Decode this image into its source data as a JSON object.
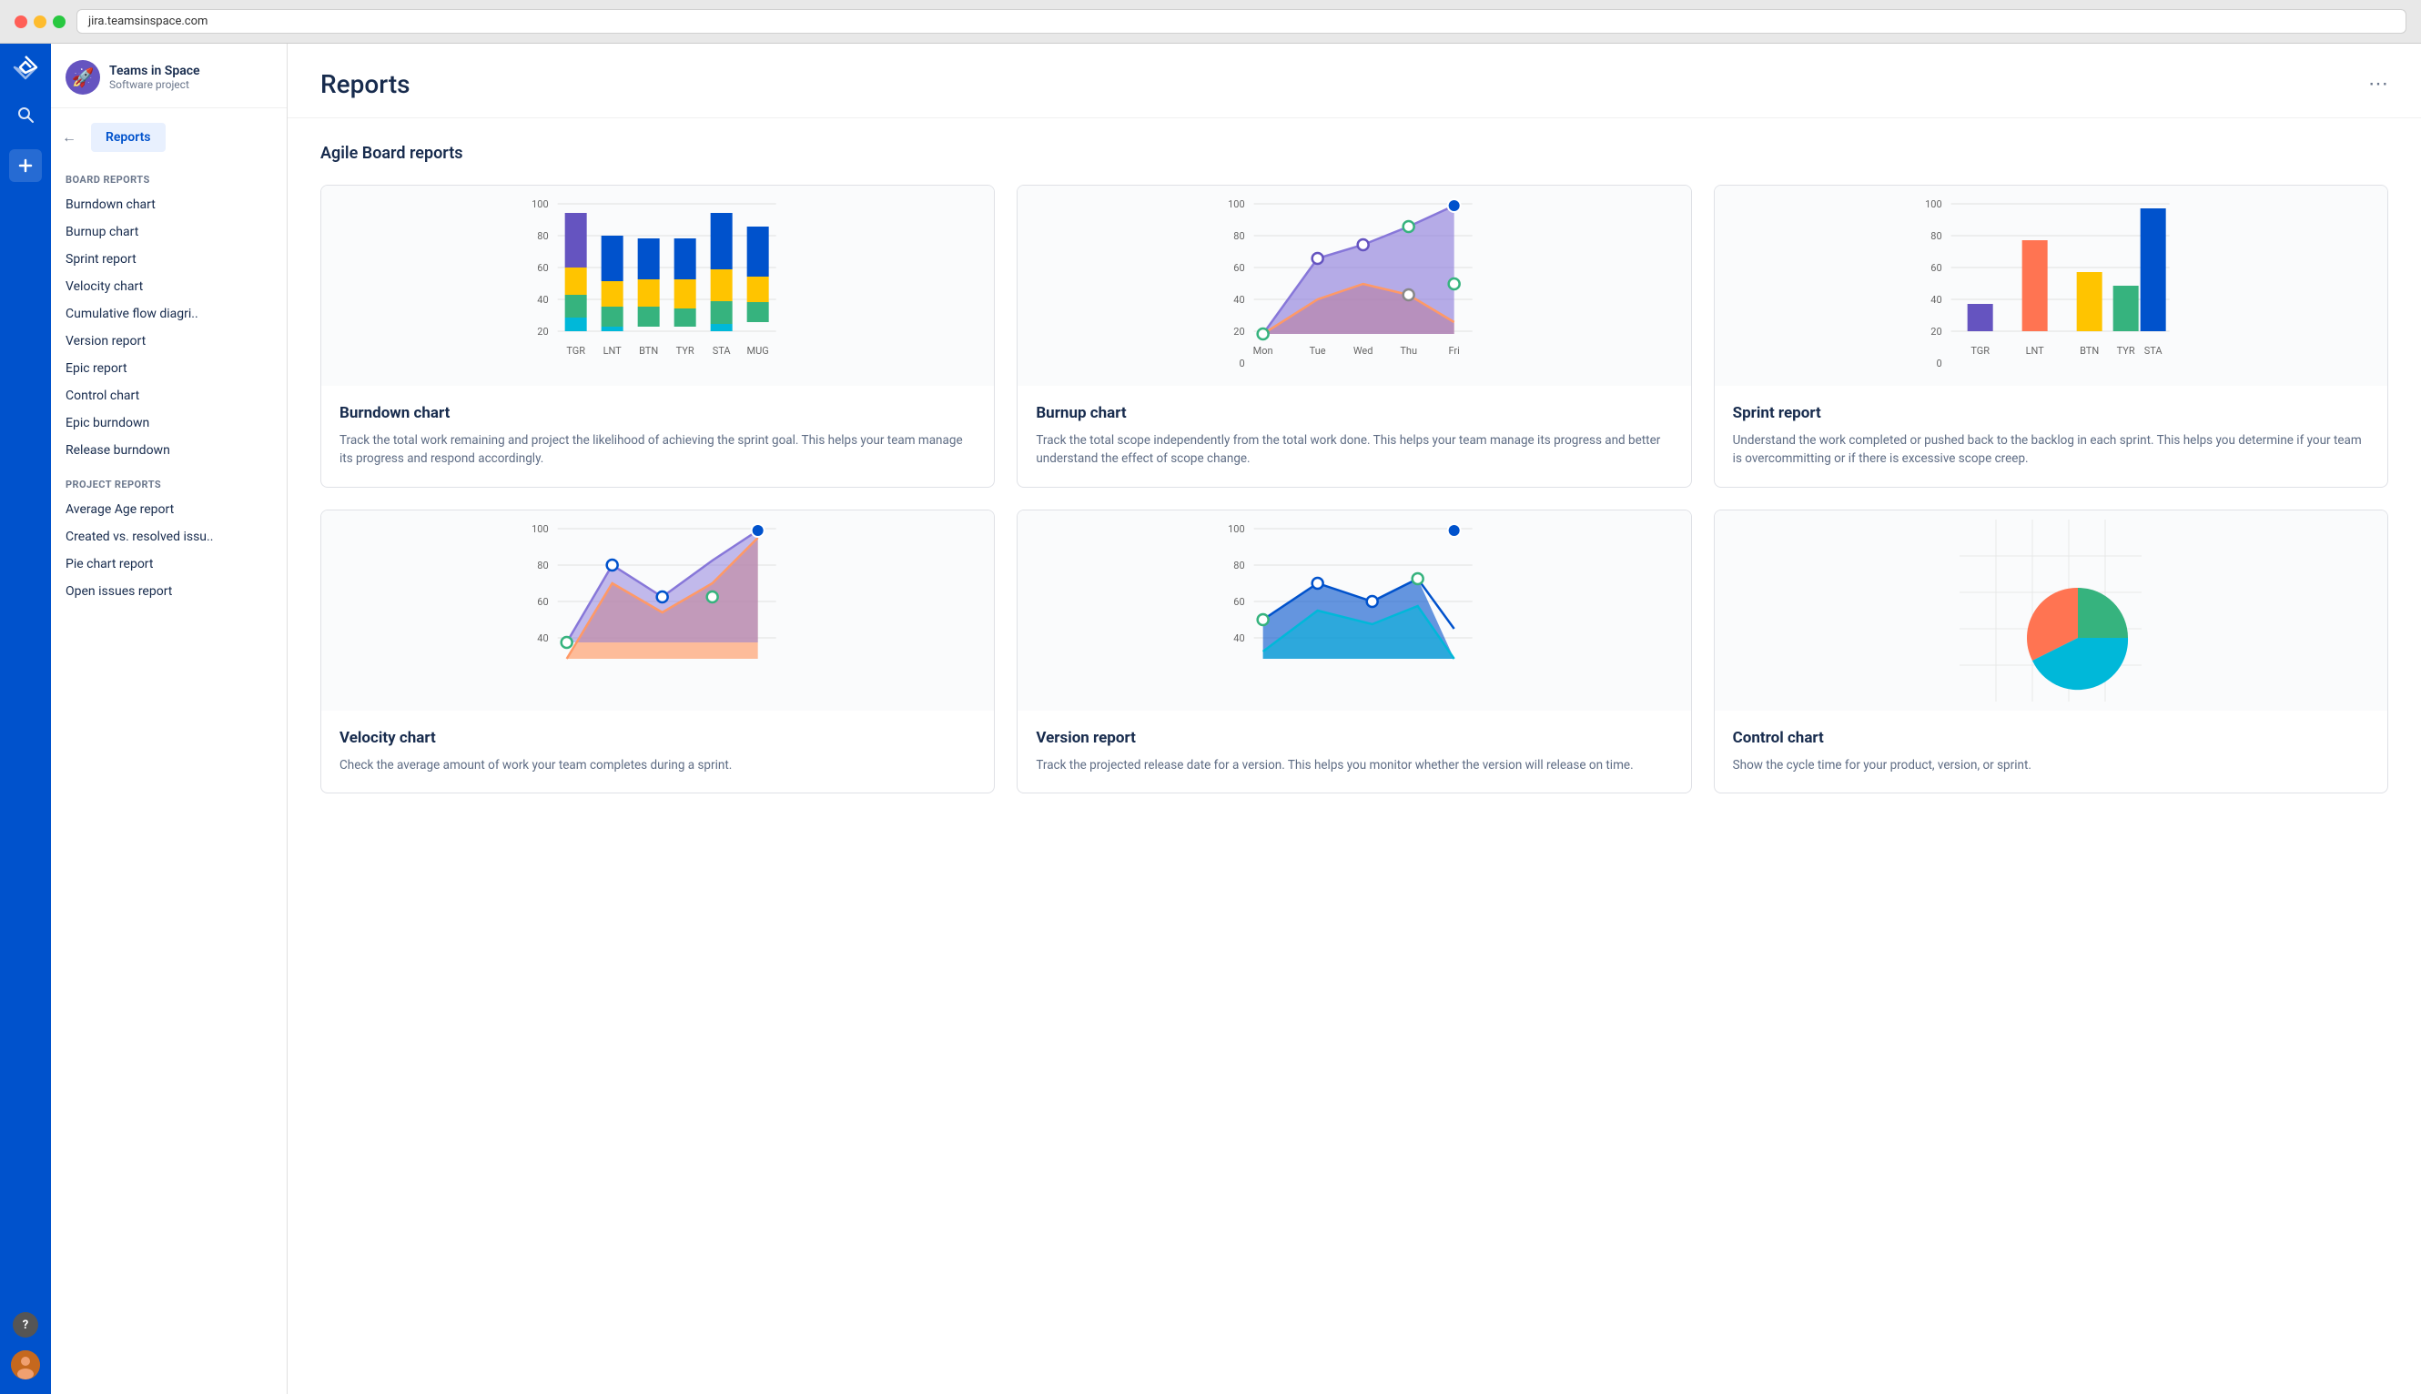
{
  "browser": {
    "url": "jira.teamsinspace.com"
  },
  "project": {
    "name": "Teams in Space",
    "type": "Software project",
    "emoji": "🚀"
  },
  "page": {
    "title": "Reports",
    "section": "Agile Board reports",
    "more_label": "⋯"
  },
  "nav": {
    "back_label": "Reports",
    "board_reports_label": "BOARD REPORTS",
    "project_reports_label": "PROJECT REPORTS",
    "board_items": [
      "Burndown chart",
      "Burnup chart",
      "Sprint report",
      "Velocity chart",
      "Cumulative flow diagri..",
      "Version report",
      "Epic report",
      "Control chart",
      "Epic burndown",
      "Release burndown"
    ],
    "project_items": [
      "Average Age report",
      "Created vs. resolved issu..",
      "Pie chart report",
      "Open issues report"
    ]
  },
  "cards": [
    {
      "id": "burndown",
      "title": "Burndown chart",
      "description": "Track the total work remaining and project the likelihood of achieving the sprint goal. This helps your team manage its progress and respond accordingly."
    },
    {
      "id": "burnup",
      "title": "Burnup chart",
      "description": "Track the total scope independently from the total work done. This helps your team manage its progress and better understand the effect of scope change."
    },
    {
      "id": "sprint",
      "title": "Sprint report",
      "description": "Understand the work completed or pushed back to the backlog in each sprint. This helps you determine if your team is overcommitting or if there is excessive scope creep."
    },
    {
      "id": "velocity",
      "title": "Velocity chart",
      "description": "Check the average amount of work your team completes during a sprint."
    },
    {
      "id": "version",
      "title": "Version report",
      "description": "Track the projected release date for a version. This helps you monitor whether the version will release on time."
    },
    {
      "id": "control",
      "title": "Control chart",
      "description": "Show the cycle time for your product, version, or sprint."
    }
  ],
  "icons": {
    "search": "🔍",
    "plus": "+",
    "help": "?",
    "back_arrow": "←"
  }
}
